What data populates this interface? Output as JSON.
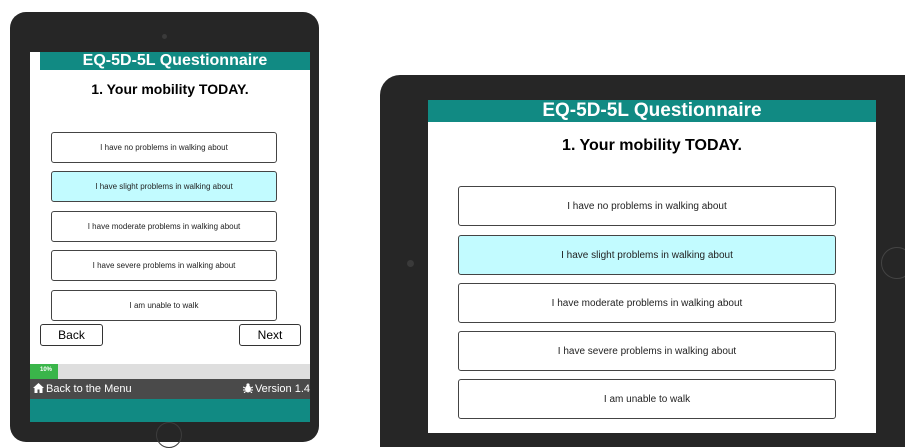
{
  "colors": {
    "header": "#118a83",
    "selected_option": "#c2fbff",
    "progress": "#3ab54a",
    "footer": "#4a4a4a"
  },
  "questionnaire": {
    "title": "EQ-5D-5L Questionnaire",
    "question": "1. Your mobility TODAY.",
    "options": [
      "I have no problems in walking about",
      "I have slight problems in walking about",
      "I have moderate problems in walking about",
      "I have severe problems in walking about",
      "I am unable to walk"
    ],
    "selected_index": 1
  },
  "navigation": {
    "back_label": "Back",
    "next_label": "Next"
  },
  "progress": {
    "label": "10%",
    "value": 0.1
  },
  "footer": {
    "menu_link": "Back to the Menu",
    "menu_icon": "home-icon",
    "version": "Version 1.4",
    "version_icon": "bug-icon"
  }
}
